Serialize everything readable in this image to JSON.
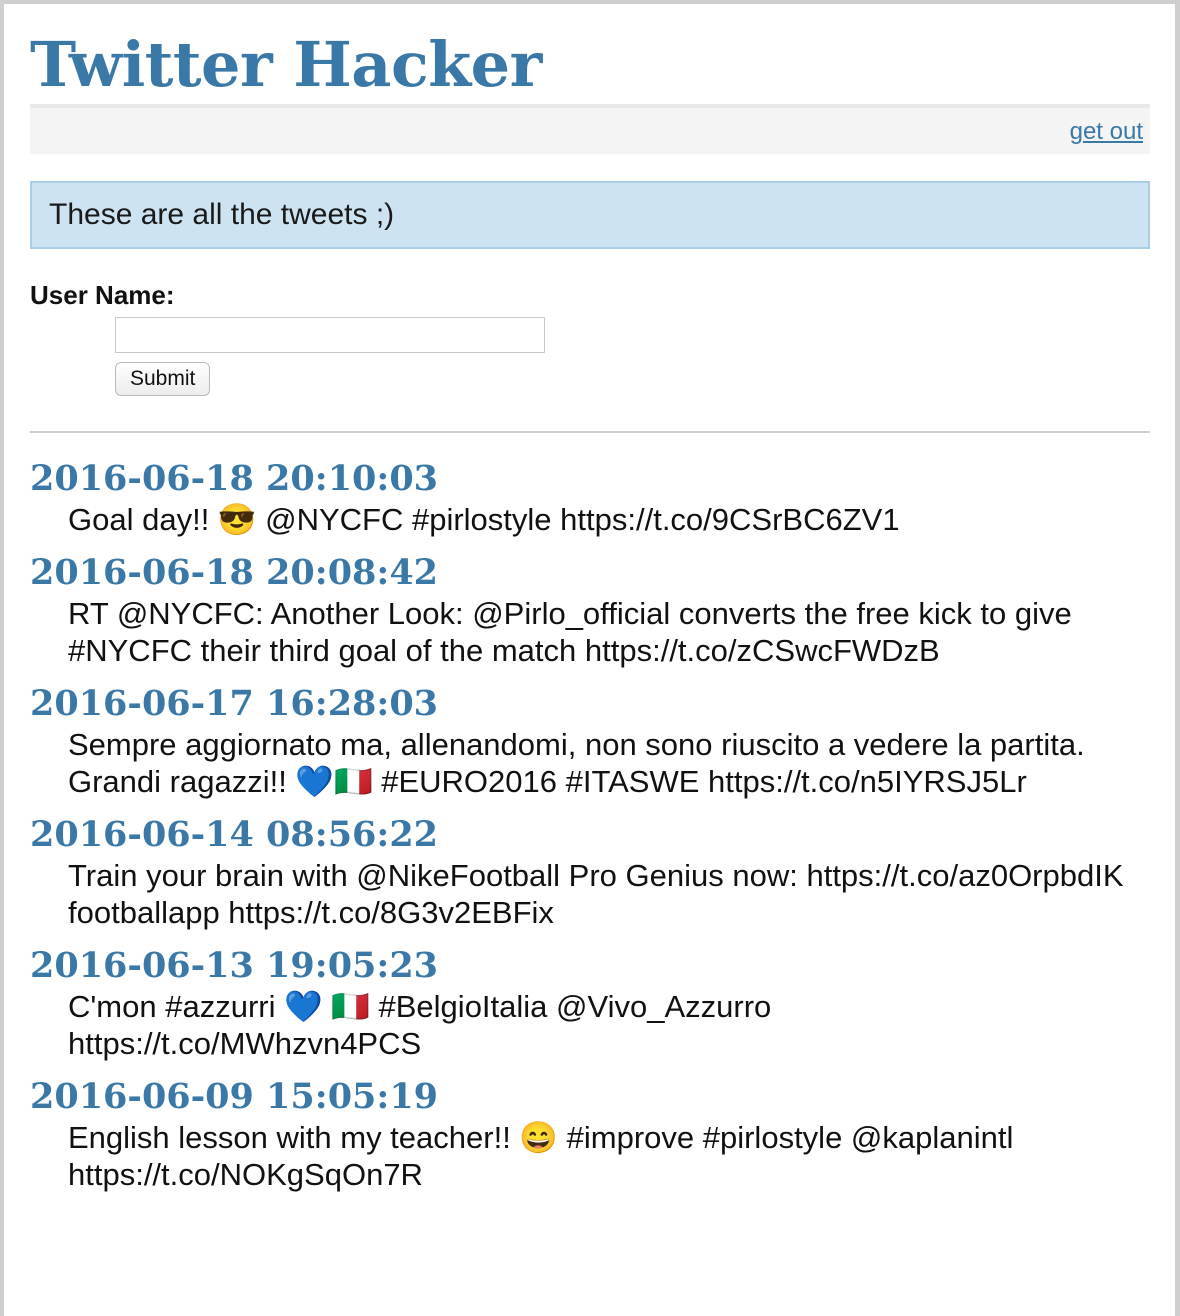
{
  "app": {
    "title": "Twitter Hacker"
  },
  "nav": {
    "logout": "get out"
  },
  "notice": {
    "text": "These are all the tweets ;)"
  },
  "form": {
    "label": "User Name:",
    "username_value": "",
    "submit_label": "Submit"
  },
  "tweets": [
    {
      "date": "2016-06-18 20:10:03",
      "text": "Goal day!! 😎 @NYCFC #pirlostyle https://t.co/9CSrBC6ZV1"
    },
    {
      "date": "2016-06-18 20:08:42",
      "text": "RT @NYCFC: Another Look: @Pirlo_official converts the free kick to give #NYCFC their third goal of the match https://t.co/zCSwcFWDzB"
    },
    {
      "date": "2016-06-17 16:28:03",
      "text": "Sempre aggiornato ma, allenandomi, non sono riuscito a vedere la partita. Grandi ragazzi!! 💙🇮🇹 #EURO2016 #ITASWE https://t.co/n5IYRSJ5Lr"
    },
    {
      "date": "2016-06-14 08:56:22",
      "text": "Train your brain with @NikeFootball Pro Genius now: https://t.co/az0OrpbdIK footballapp https://t.co/8G3v2EBFix"
    },
    {
      "date": "2016-06-13 19:05:23",
      "text": "C'mon #azzurri 💙 🇮🇹 #BelgioItalia @Vivo_Azzurro https://t.co/MWhzvn4PCS"
    },
    {
      "date": "2016-06-09 15:05:19",
      "text": "English lesson with my teacher!! 😄 #improve #pirlostyle @kaplanintl https://t.co/NOKgSqOn7R"
    }
  ],
  "colors": {
    "accent": "#3a78a8",
    "notice_bg": "#cde3f1",
    "notice_border": "#a9cfe6"
  }
}
